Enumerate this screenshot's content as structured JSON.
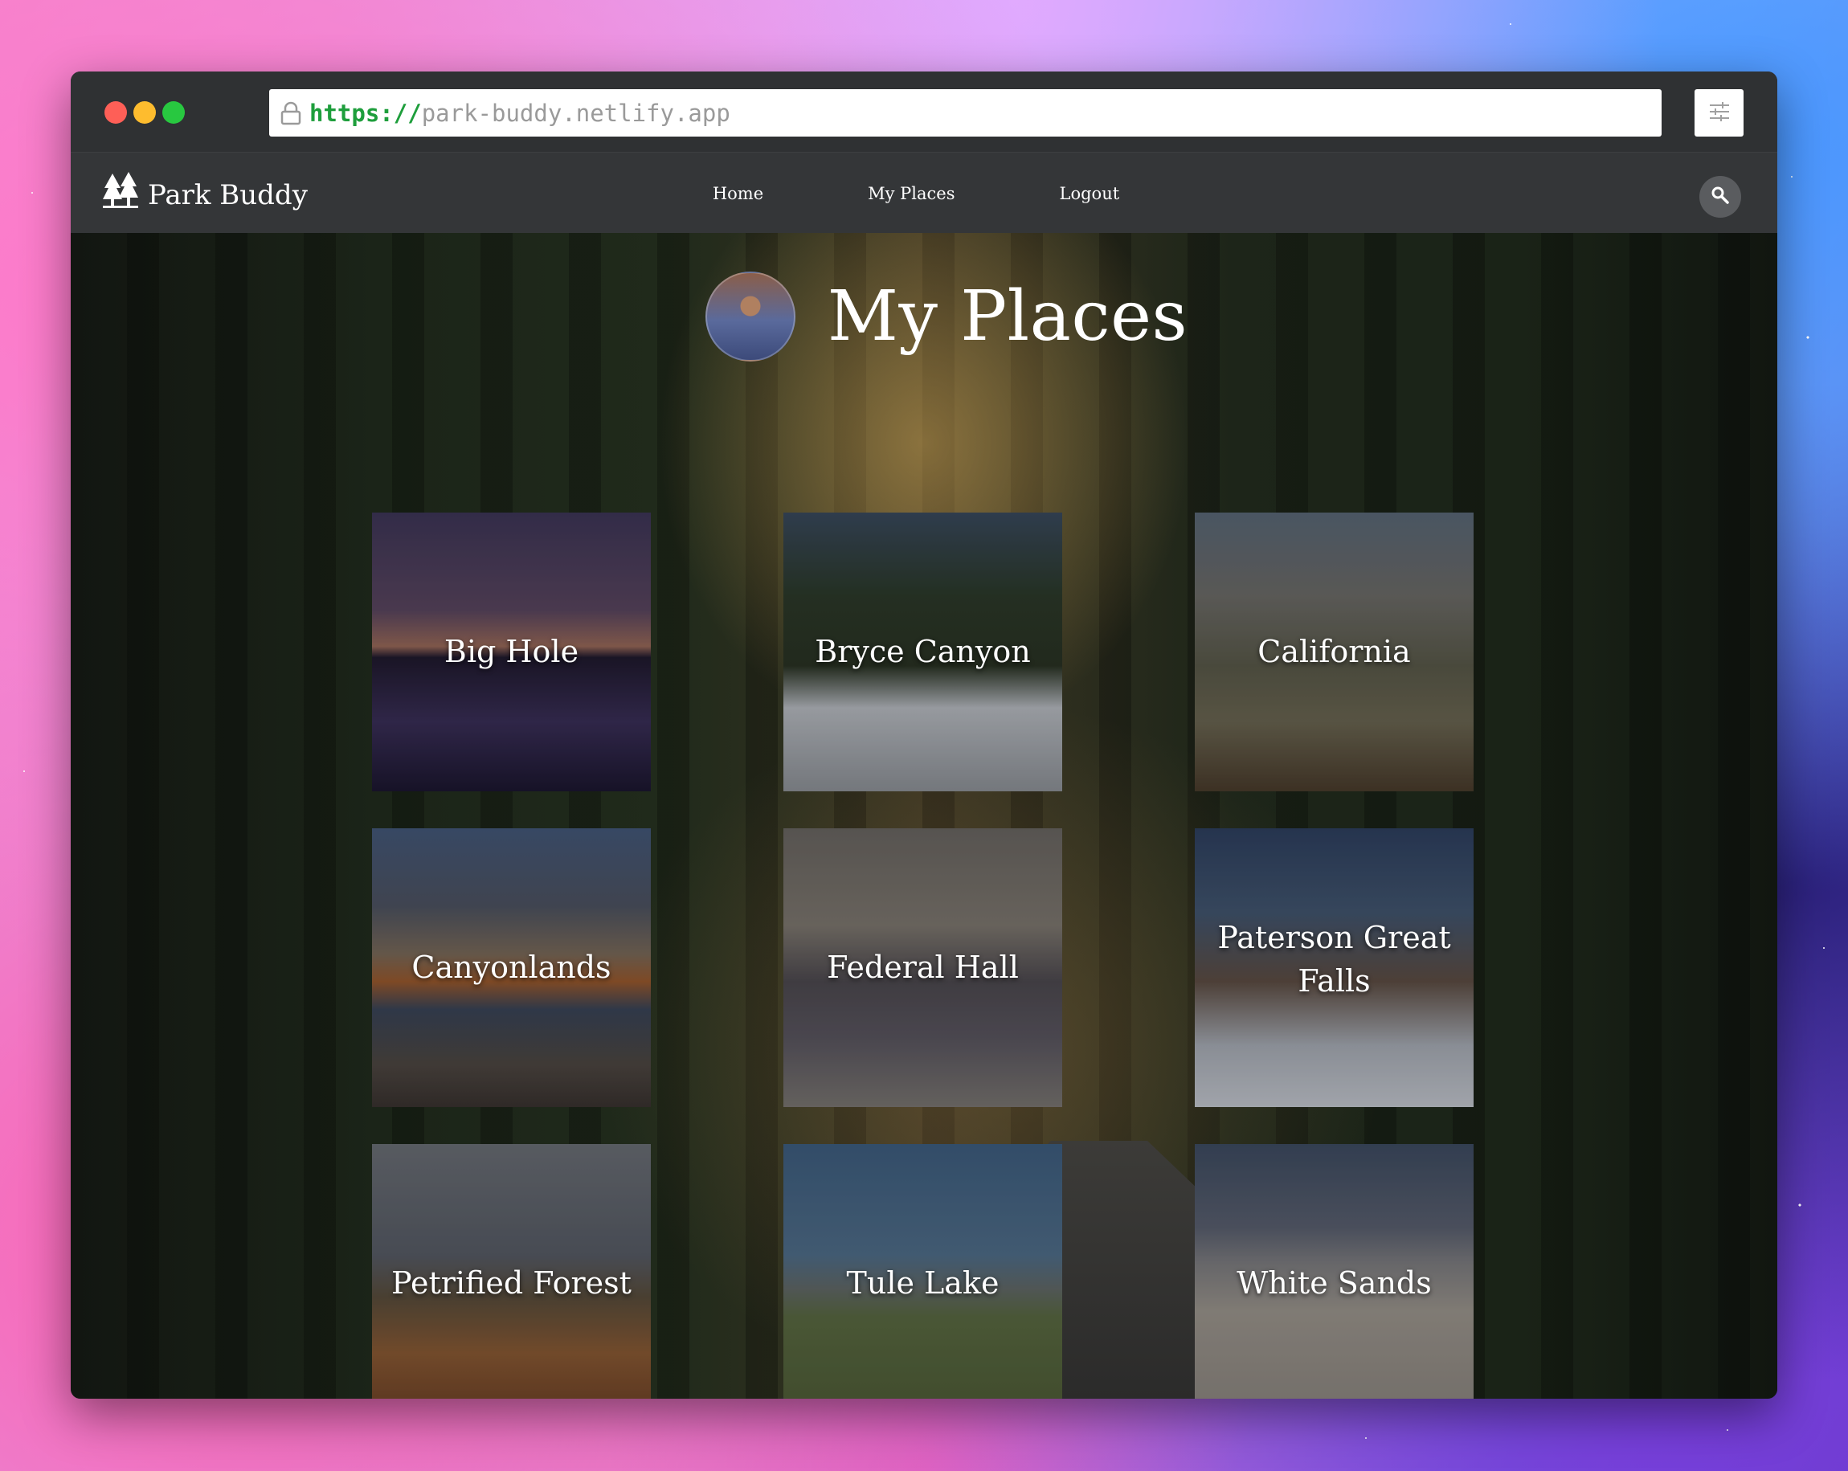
{
  "browser": {
    "url_scheme": "https://",
    "url_host": "park-buddy.netlify.app"
  },
  "nav": {
    "brand": "Park Buddy",
    "links": [
      "Home",
      "My Places",
      "Logout"
    ]
  },
  "page": {
    "title": "My Places"
  },
  "places": [
    {
      "name": "Big Hole"
    },
    {
      "name": "Bryce Canyon"
    },
    {
      "name": "California"
    },
    {
      "name": "Canyonlands"
    },
    {
      "name": "Federal Hall"
    },
    {
      "name": "Paterson Great Falls"
    },
    {
      "name": "Petrified Forest"
    },
    {
      "name": "Tule Lake"
    },
    {
      "name": "White Sands"
    }
  ],
  "colors": {
    "url_scheme": "#1e9e3c",
    "window_chrome": "#2f3133",
    "navbar": "#343638"
  }
}
